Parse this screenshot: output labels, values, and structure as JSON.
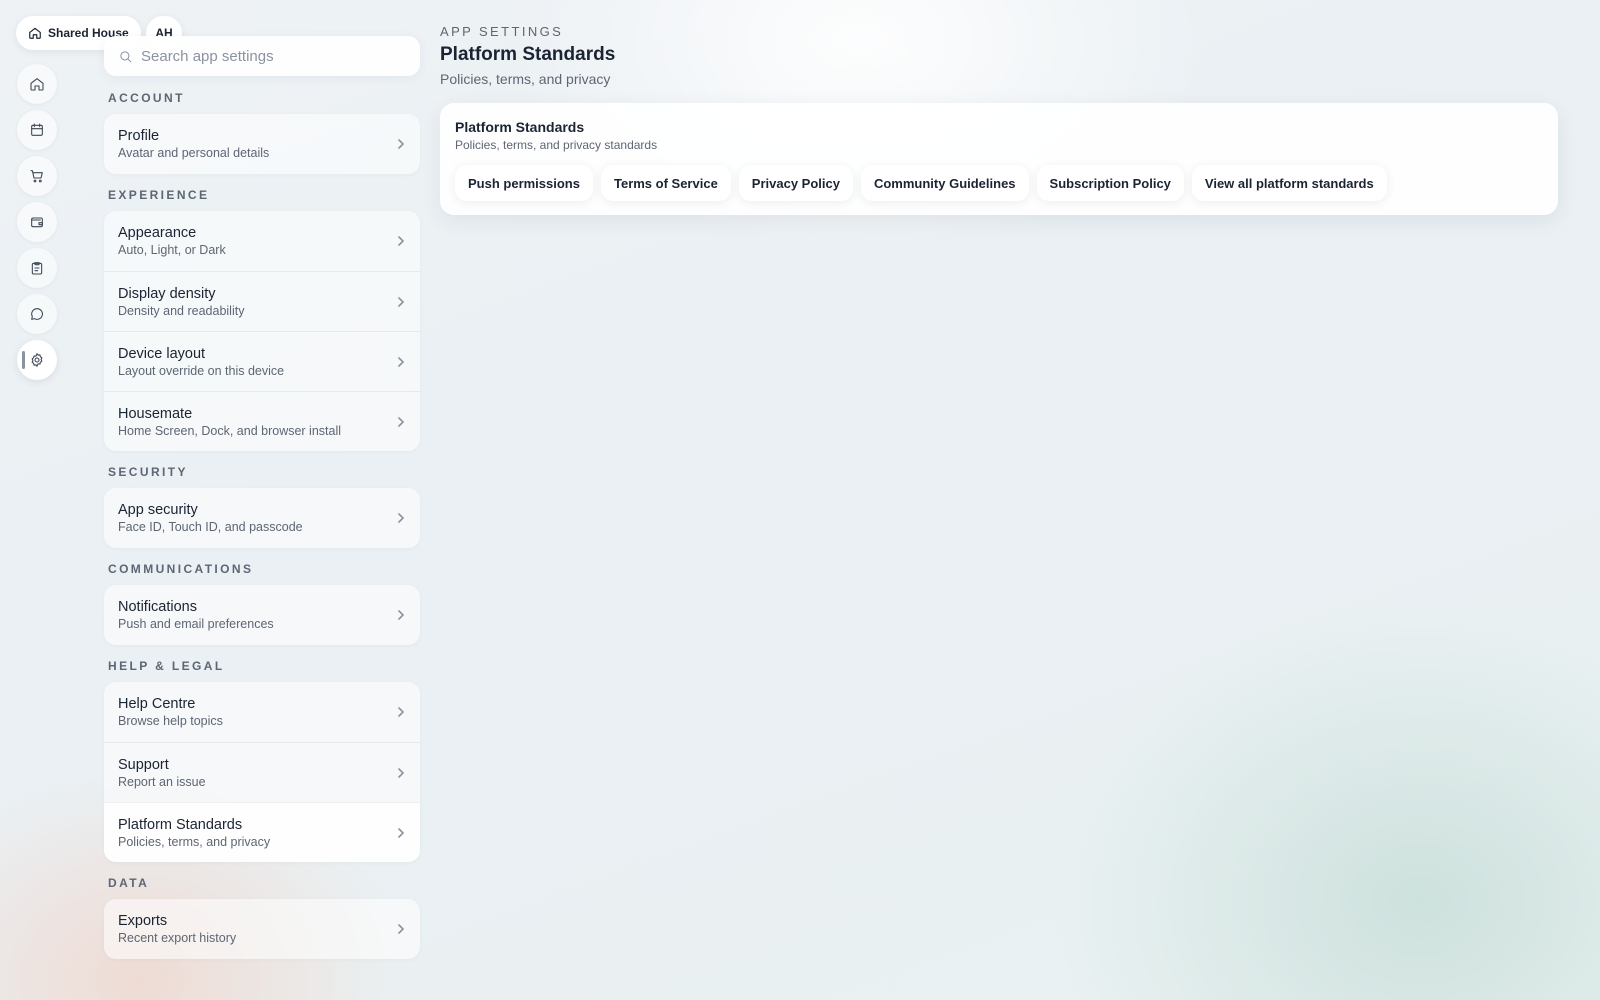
{
  "top": {
    "house_label": "Shared House",
    "avatar_initials": "AH"
  },
  "rail": {
    "items": [
      {
        "icon": "home-icon"
      },
      {
        "icon": "calendar-icon"
      },
      {
        "icon": "cart-icon"
      },
      {
        "icon": "wallet-icon"
      },
      {
        "icon": "clipboard-icon"
      },
      {
        "icon": "chat-icon"
      },
      {
        "icon": "gear-icon",
        "active": true
      }
    ]
  },
  "search": {
    "placeholder": "Search app settings"
  },
  "sections": {
    "account": {
      "label": "Account",
      "items": [
        {
          "title": "Profile",
          "subtitle": "Avatar and personal details"
        }
      ]
    },
    "experience": {
      "label": "Experience",
      "items": [
        {
          "title": "Appearance",
          "subtitle": "Auto, Light, or Dark"
        },
        {
          "title": "Display density",
          "subtitle": "Density and readability"
        },
        {
          "title": "Device layout",
          "subtitle": "Layout override on this device"
        },
        {
          "title": "Housemate",
          "subtitle": "Home Screen, Dock, and browser install"
        }
      ]
    },
    "security": {
      "label": "Security",
      "items": [
        {
          "title": "App security",
          "subtitle": "Face ID, Touch ID, and passcode"
        }
      ]
    },
    "communications": {
      "label": "Communications",
      "items": [
        {
          "title": "Notifications",
          "subtitle": "Push and email preferences"
        }
      ]
    },
    "help_legal": {
      "label": "Help & Legal",
      "items": [
        {
          "title": "Help Centre",
          "subtitle": "Browse help topics"
        },
        {
          "title": "Support",
          "subtitle": "Report an issue"
        },
        {
          "title": "Platform Standards",
          "subtitle": "Policies, terms, and privacy",
          "selected": true
        }
      ]
    },
    "data": {
      "label": "Data",
      "items": [
        {
          "title": "Exports",
          "subtitle": "Recent export history"
        }
      ]
    }
  },
  "main": {
    "eyebrow": "App Settings",
    "title": "Platform Standards",
    "subtitle": "Policies, terms, and privacy",
    "card": {
      "title": "Platform Standards",
      "subtitle": "Policies, terms, and privacy standards",
      "chips": [
        "Push permissions",
        "Terms of Service",
        "Privacy Policy",
        "Community Guidelines",
        "Subscription Policy",
        "View all platform standards"
      ]
    }
  }
}
